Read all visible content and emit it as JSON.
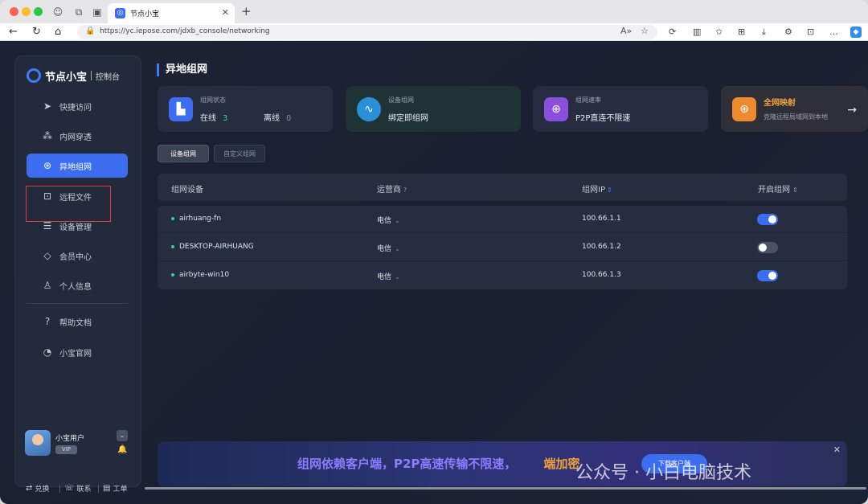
{
  "browser": {
    "tab_title": "节点小宝",
    "tab_favicon": "node-logo-icon",
    "url": "https://yc.iepose.com/jdxb_console/networking",
    "traffic_colors": [
      "#ff5f57",
      "#febc2e",
      "#28c840"
    ]
  },
  "sidebar": {
    "logo_text": "节点小宝",
    "logo_sub": "控制台",
    "items": [
      {
        "label": "快捷访问",
        "icon": "paper-plane-icon"
      },
      {
        "label": "内网穿透",
        "icon": "network-nodes-icon"
      },
      {
        "label": "异地组网",
        "icon": "globe-hand-icon",
        "active": true
      },
      {
        "label": "远程文件",
        "icon": "folder-upload-icon"
      },
      {
        "label": "设备管理",
        "icon": "server-icon"
      },
      {
        "label": "会员中心",
        "icon": "diamond-icon"
      },
      {
        "label": "个人信息",
        "icon": "user-icon"
      },
      {
        "label": "帮助文档",
        "icon": "help-doc-icon"
      },
      {
        "label": "小宝官网",
        "icon": "clock-globe-icon"
      }
    ],
    "user": {
      "name": "小宝用户",
      "badge": "VIP"
    },
    "footer": [
      {
        "label": "兑换",
        "icon": "exchange-icon"
      },
      {
        "label": "联系",
        "icon": "chat-icon"
      },
      {
        "label": "工单",
        "icon": "ticket-icon"
      }
    ]
  },
  "main": {
    "title": "异地组网",
    "cards": [
      {
        "title": "组网状态",
        "online_label": "在线",
        "online_value": "3",
        "offline_label": "离线",
        "offline_value": "0",
        "icon": "dashboard-icon",
        "color": "#3c6df0"
      },
      {
        "title": "设备组网",
        "value": "绑定即组网",
        "icon": "messenger-icon",
        "color": "#2a8fd9"
      },
      {
        "title": "组网速率",
        "value": "P2P直连不限速",
        "icon": "globe-icon",
        "color": "#8a4fdc"
      },
      {
        "title": "全网映射",
        "value": "克隆远程局域网到本地",
        "icon": "globe-map-icon",
        "color": "#f08a2e"
      }
    ],
    "tabs": [
      {
        "label": "设备组网",
        "active": true
      },
      {
        "label": "自定义组网",
        "active": false
      }
    ],
    "table": {
      "headers": [
        "组网设备",
        "运营商",
        "组网IP",
        "开启组网"
      ],
      "rows": [
        {
          "device": "airhuang-fn",
          "isp": "电信",
          "ip": "100.66.1.1",
          "enabled": true
        },
        {
          "device": "DESKTOP-AIRHUANG",
          "isp": "电信",
          "ip": "100.66.1.2",
          "enabled": false
        },
        {
          "device": "airbyte-win10",
          "isp": "电信",
          "ip": "100.66.1.3",
          "enabled": true
        }
      ]
    },
    "banner": {
      "text": "组网依赖客户端，P2P高速传输不限速，",
      "text_tail": "端加密",
      "button": "下载客户端"
    },
    "watermark": "公众号 · 小白电脑技术"
  }
}
